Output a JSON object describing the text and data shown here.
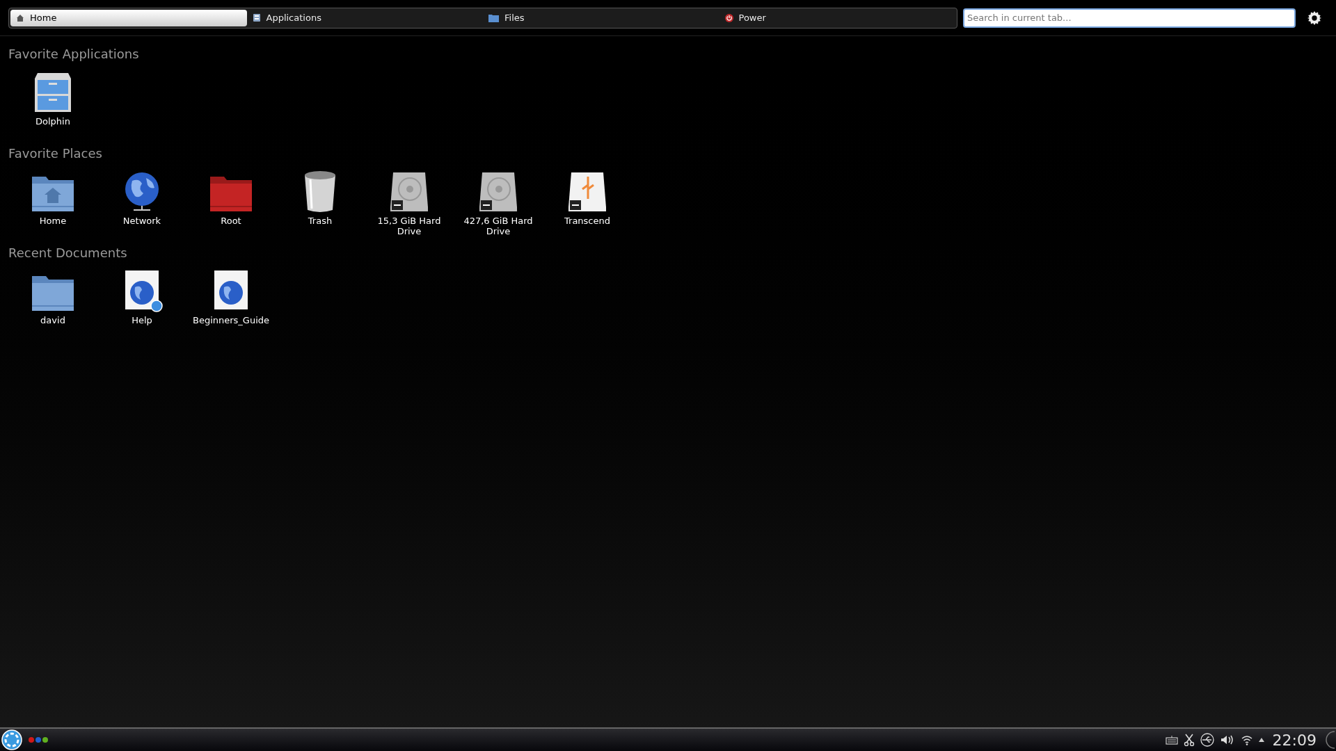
{
  "tabs": [
    {
      "label": "Home",
      "kind": "home",
      "selected": true
    },
    {
      "label": "Applications",
      "kind": "applications",
      "selected": false
    },
    {
      "label": "Files",
      "kind": "files",
      "selected": false
    },
    {
      "label": "Power",
      "kind": "power",
      "selected": false
    }
  ],
  "search": {
    "placeholder": "Search in current tab..."
  },
  "sections": [
    {
      "title": "Favorite Applications",
      "items": [
        {
          "label": "Dolphin",
          "kind": "cabinet"
        }
      ]
    },
    {
      "title": "Favorite Places",
      "items": [
        {
          "label": "Home",
          "kind": "home-folder"
        },
        {
          "label": "Network",
          "kind": "globe"
        },
        {
          "label": "Root",
          "kind": "red-folder"
        },
        {
          "label": "Trash",
          "kind": "trash"
        },
        {
          "label": "15,3 GiB Hard Drive",
          "kind": "drive"
        },
        {
          "label": "427,6 GiB Hard Drive",
          "kind": "drive"
        },
        {
          "label": "Transcend",
          "kind": "usb-drive"
        }
      ]
    },
    {
      "title": "Recent Documents",
      "items": [
        {
          "label": "david",
          "kind": "folder"
        },
        {
          "label": "Help",
          "kind": "help-document"
        },
        {
          "label": "Beginners_Guide",
          "kind": "document"
        }
      ]
    }
  ],
  "taskbar": {
    "clock": "22:09"
  }
}
